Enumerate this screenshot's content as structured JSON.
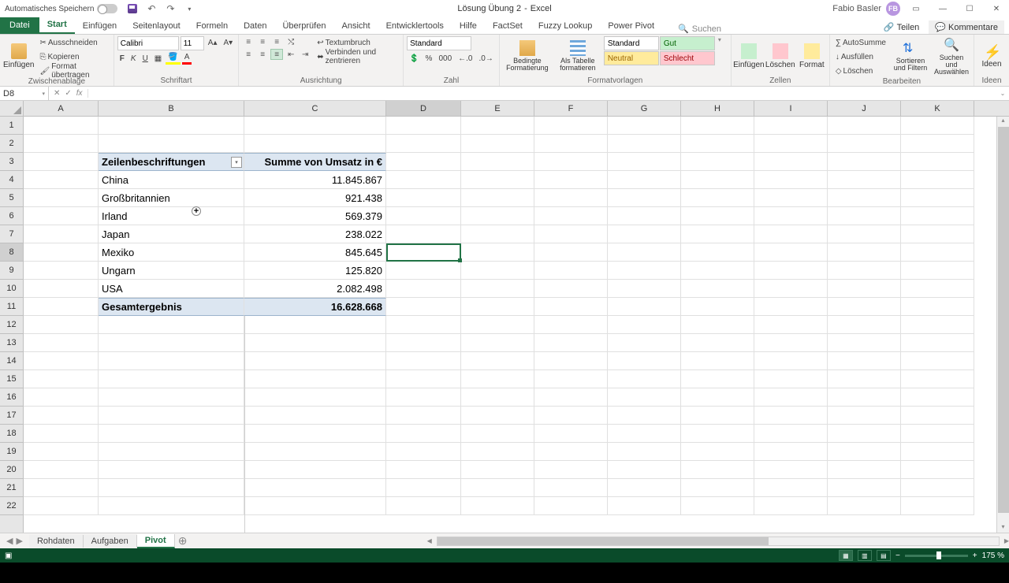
{
  "titlebar": {
    "autosave": "Automatisches Speichern",
    "doc_name": "Lösung Übung 2",
    "app_name": "Excel",
    "user_name": "Fabio Basler",
    "avatar_initials": "FB"
  },
  "ribbon_tabs": {
    "file": "Datei",
    "items": [
      "Start",
      "Einfügen",
      "Seitenlayout",
      "Formeln",
      "Daten",
      "Überprüfen",
      "Ansicht",
      "Entwicklertools",
      "Hilfe",
      "FactSet",
      "Fuzzy Lookup",
      "Power Pivot"
    ],
    "active": "Start",
    "search_placeholder": "Suchen",
    "share": "Teilen",
    "comments": "Kommentare"
  },
  "ribbon": {
    "clipboard": {
      "paste": "Einfügen",
      "cut": "Ausschneiden",
      "copy": "Kopieren",
      "painter": "Format übertragen",
      "label": "Zwischenablage"
    },
    "font": {
      "name": "Calibri",
      "size": "11",
      "label": "Schriftart"
    },
    "align": {
      "wrap": "Textumbruch",
      "merge": "Verbinden und zentrieren",
      "label": "Ausrichtung"
    },
    "number": {
      "format": "Standard",
      "label": "Zahl"
    },
    "styles": {
      "cond": "Bedingte Formatierung",
      "table": "Als Tabelle formatieren",
      "s1": "Standard",
      "s2": "Neutral",
      "s3": "Gut",
      "s4": "Schlecht",
      "label": "Formatvorlagen"
    },
    "cells": {
      "insert": "Einfügen",
      "delete": "Löschen",
      "format": "Format",
      "label": "Zellen"
    },
    "editing": {
      "sum": "AutoSumme",
      "fill": "Ausfüllen",
      "clear": "Löschen",
      "sort": "Sortieren und Filtern",
      "find": "Suchen und Auswählen",
      "label": "Bearbeiten"
    },
    "ideas": {
      "label": "Ideen"
    }
  },
  "name_box": "D8",
  "columns": [
    "A",
    "B",
    "C",
    "D",
    "E",
    "F",
    "G",
    "H",
    "I",
    "J",
    "K"
  ],
  "selected_col": "D",
  "selected_row": "8",
  "pivot": {
    "hdr_rows": "Zeilenbeschriftungen",
    "hdr_val": "Summe von Umsatz in €",
    "rows": [
      {
        "label": "China",
        "value": "11.845.867"
      },
      {
        "label": "Großbritannien",
        "value": "921.438"
      },
      {
        "label": "Irland",
        "value": "569.379"
      },
      {
        "label": "Japan",
        "value": "238.022"
      },
      {
        "label": "Mexiko",
        "value": "845.645"
      },
      {
        "label": "Ungarn",
        "value": "125.820"
      },
      {
        "label": "USA",
        "value": "2.082.498"
      }
    ],
    "total_label": "Gesamtergebnis",
    "total_value": "16.628.668"
  },
  "sheet_tabs": {
    "items": [
      "Rohdaten",
      "Aufgaben",
      "Pivot"
    ],
    "active": "Pivot"
  },
  "status": {
    "zoom": "175 %"
  }
}
